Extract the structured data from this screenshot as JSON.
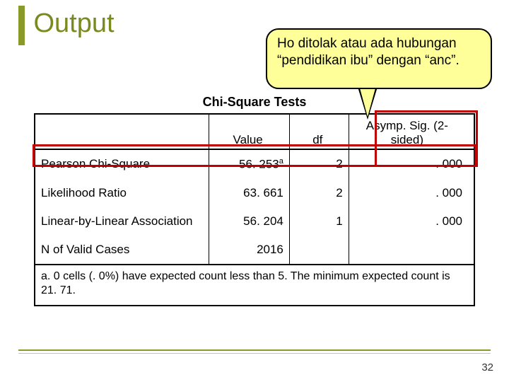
{
  "title": "Output",
  "callout": {
    "line1": "Ho ditolak atau ada hubungan",
    "line2": "“pendidikan ibu” dengan “anc”."
  },
  "table": {
    "caption": "Chi-Square Tests",
    "headers": {
      "value": "Value",
      "df": "df",
      "asymp": "Asymp. Sig. (2-sided)"
    },
    "rows": [
      {
        "label": "Pearson Chi-Square",
        "value": "56. 253",
        "sup": "a",
        "df": "2",
        "sig": ". 000"
      },
      {
        "label": "Likelihood Ratio",
        "value": "63. 661",
        "sup": "",
        "df": "2",
        "sig": ". 000"
      },
      {
        "label": "Linear-by-Linear Association",
        "value": "56. 204",
        "sup": "",
        "df": "1",
        "sig": ". 000"
      },
      {
        "label": "N of Valid Cases",
        "value": "2016",
        "sup": "",
        "df": "",
        "sig": ""
      }
    ],
    "footnote": "a. 0 cells (. 0%) have expected count less than 5. The minimum expected count is 21. 71."
  },
  "page_number": "32",
  "chart_data": {
    "type": "table",
    "title": "Chi-Square Tests",
    "columns": [
      "",
      "Value",
      "df",
      "Asymp. Sig. (2-sided)"
    ],
    "rows": [
      [
        "Pearson Chi-Square",
        56.253,
        2,
        0.0
      ],
      [
        "Likelihood Ratio",
        63.661,
        2,
        0.0
      ],
      [
        "Linear-by-Linear Association",
        56.204,
        1,
        0.0
      ],
      [
        "N of Valid Cases",
        2016,
        null,
        null
      ]
    ],
    "footnote": "0 cells (.0%) have expected count less than 5. The minimum expected count is 21.71."
  }
}
